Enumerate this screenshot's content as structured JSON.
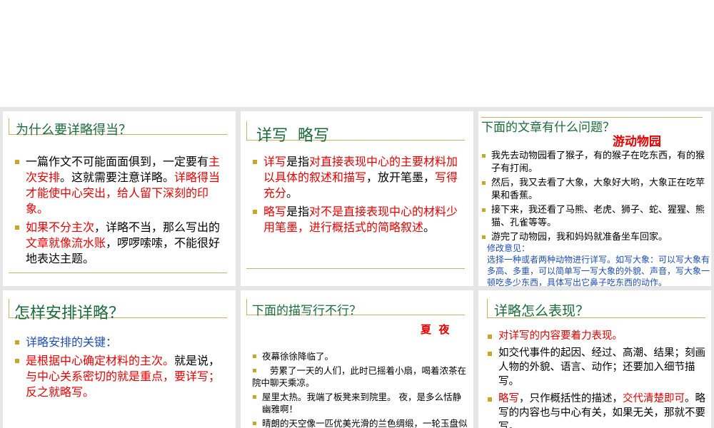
{
  "slides": {
    "s1": {
      "title": "为什么要详略得当？",
      "b1": {
        "p1": "一篇作文不可能面面俱到，一定要有",
        "p2": "主次安排",
        "p3": "。这就需要注意详略。",
        "p4": "详略得当才能使中心突出，给人留下深刻的印象。"
      },
      "b2": {
        "p1": "如果不分主次",
        "p2": "，详略不当，那么写出的",
        "p3": "文章就像流水账",
        "p4": "，啰啰嗦嗦，不能很好地表达主题。"
      }
    },
    "s2": {
      "title": "详写  略写",
      "b1": {
        "p1": "详写",
        "p2": "是指",
        "p3": "对直接表现中心的主要材料加以具体的叙述和描写",
        "p4": "，放开笔墨，",
        "p5": "写得充分",
        "p6": "。"
      },
      "b2": {
        "p1": "略写",
        "p2": "是指",
        "p3": "对不是直接表现中心的材料少用笔墨，进行概括式的简略叙述",
        "p4": "。"
      }
    },
    "s3": {
      "title": "下面的文章有什么问题？",
      "subtitle": "游动物园",
      "items": [
        "我先去动物园看了猴子，有的猴子在吃东西，有的猴子有打闹。",
        "然后，我又去看了大象，大象好大哟，大象正在吃苹果和香蕉。",
        "接下来，我还看了马熊、老虎、狮子、蛇、猩猩、熊猫、孔雀等等。",
        "游完了动物园，我和妈妈就准备坐车回家。"
      ],
      "note_label": "修改意见：",
      "note_text": "选择一种或者两种动物进行详写。如写大象：可以写大象有多高、多重，可以简单写一写大象的外貌、声音，写大象一顿吃多少东西，具体写出它鼻子吃东西的动作。"
    },
    "s4": {
      "title": "怎样安排详略？",
      "b1": "详略安排的关键：",
      "b2": {
        "p1": "是根据中心确定材料的主次。",
        "p2": "就是说，",
        "p3": "与中心关系密切的就是重点，要详写；反之就略写。"
      }
    },
    "s5": {
      "title": "下面的描写行不行？",
      "subtitle": "夏  夜",
      "items": [
        "夜幕徐徐降临了。",
        "劳累了一天的人们，此时已摇着小扇，喝着浓茶在院中聊天乘凉。",
        "屋里太热。我端了板凳来到院里。  夜，是多么恬静幽雅啊！",
        "晴朗的天空像一匹优美光滑的兰色绸缎，一轮玉盘似的满月，把它那皎洁的光华洒向人间。"
      ]
    },
    "s6": {
      "title": "详略怎么表现？",
      "b1": "对详写的内容要着力表现。",
      "b2": "如交代事件的起因、经过、高潮、结果；刻画人物的外貌、语言、动作；还要加入细节描写。",
      "b3": {
        "p1": "略写",
        "p2": "，只作概括性的描述，",
        "p3": "交代清楚即可",
        "p4": "。略写的内容也与中心有关，如果无关，那就不要写。"
      }
    }
  }
}
